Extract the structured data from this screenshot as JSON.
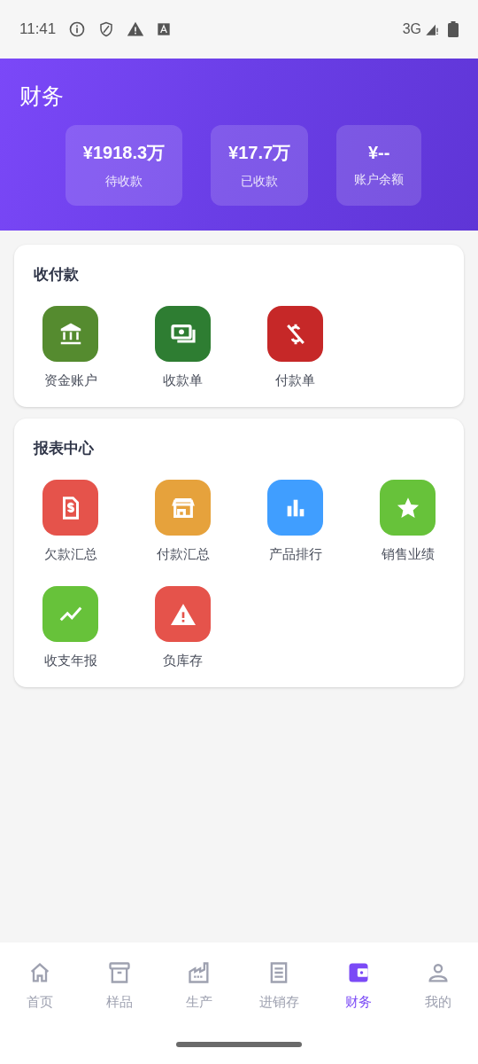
{
  "status_bar": {
    "time": "11:41",
    "network": "3G"
  },
  "header": {
    "title": "财务",
    "stats": [
      {
        "value": "¥1918.3万",
        "label": "待收款"
      },
      {
        "value": "¥17.7万",
        "label": "已收款"
      },
      {
        "value": "¥--",
        "label": "账户余额"
      }
    ]
  },
  "sections": [
    {
      "title": "收付款",
      "items": [
        {
          "label": "资金账户",
          "color": "#558b2f"
        },
        {
          "label": "收款单",
          "color": "#2e7d32"
        },
        {
          "label": "付款单",
          "color": "#c62828"
        }
      ]
    },
    {
      "title": "报表中心",
      "items": [
        {
          "label": "欠款汇总",
          "color": "#e5534b"
        },
        {
          "label": "付款汇总",
          "color": "#e6a23c"
        },
        {
          "label": "产品排行",
          "color": "#409eff"
        },
        {
          "label": "销售业绩",
          "color": "#67c23a"
        },
        {
          "label": "收支年报",
          "color": "#67c23a"
        },
        {
          "label": "负库存",
          "color": "#e5534b"
        }
      ]
    }
  ],
  "tab_bar": [
    {
      "label": "首页",
      "selected": false
    },
    {
      "label": "样品",
      "selected": false
    },
    {
      "label": "生产",
      "selected": false
    },
    {
      "label": "进销存",
      "selected": false
    },
    {
      "label": "财务",
      "selected": true
    },
    {
      "label": "我的",
      "selected": false
    }
  ]
}
